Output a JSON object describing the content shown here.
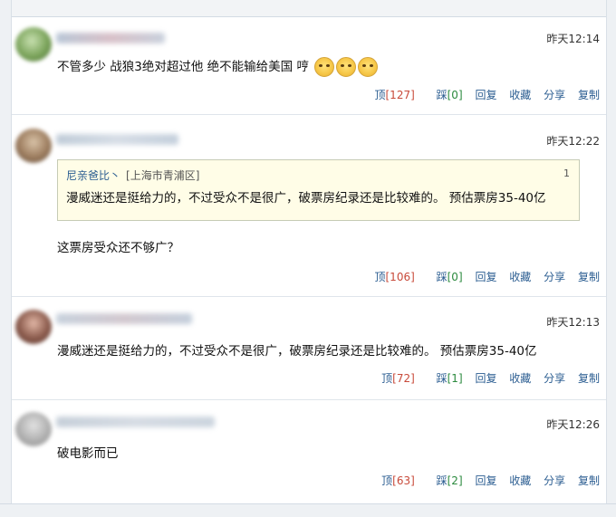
{
  "comments": [
    {
      "time": "昨天12:14",
      "text": "不管多少 战狼3绝对超过他 绝不能输给美国 哼",
      "emojis": [
        "emoji-face",
        "emoji-face",
        "emoji-face"
      ],
      "actions": {
        "ding": "顶",
        "ding_count": "[127]",
        "cai": "踩",
        "cai_count": "[0]",
        "reply": "回复",
        "favorite": "收藏",
        "share": "分享",
        "copy": "复制"
      }
    },
    {
      "time": "昨天12:22",
      "quote": {
        "author": "尼亲爸比丶",
        "location": "[上海市青浦区]",
        "floor": "1",
        "text": "漫威迷还是挺给力的，不过受众不是很广，破票房纪录还是比较难的。 预估票房35-40亿"
      },
      "text": "这票房受众还不够广？",
      "actions": {
        "ding": "顶",
        "ding_count": "[106]",
        "cai": "踩",
        "cai_count": "[0]",
        "reply": "回复",
        "favorite": "收藏",
        "share": "分享",
        "copy": "复制"
      }
    },
    {
      "time": "昨天12:13",
      "text": "漫威迷还是挺给力的，不过受众不是很广，破票房纪录还是比较难的。 预估票房35-40亿",
      "actions": {
        "ding": "顶",
        "ding_count": "[72]",
        "cai": "踩",
        "cai_count": "[1]",
        "reply": "回复",
        "favorite": "收藏",
        "share": "分享",
        "copy": "复制"
      }
    },
    {
      "time": "昨天12:26",
      "text": "破电影而已",
      "actions": {
        "ding": "顶",
        "ding_count": "[63]",
        "cai": "踩",
        "cai_count": "[2]",
        "reply": "回复",
        "favorite": "收藏",
        "share": "分享",
        "copy": "复制"
      }
    }
  ],
  "colors": {
    "link": "#2b5d91",
    "count": "#c84a3a",
    "quote_bg": "#fffde7"
  }
}
